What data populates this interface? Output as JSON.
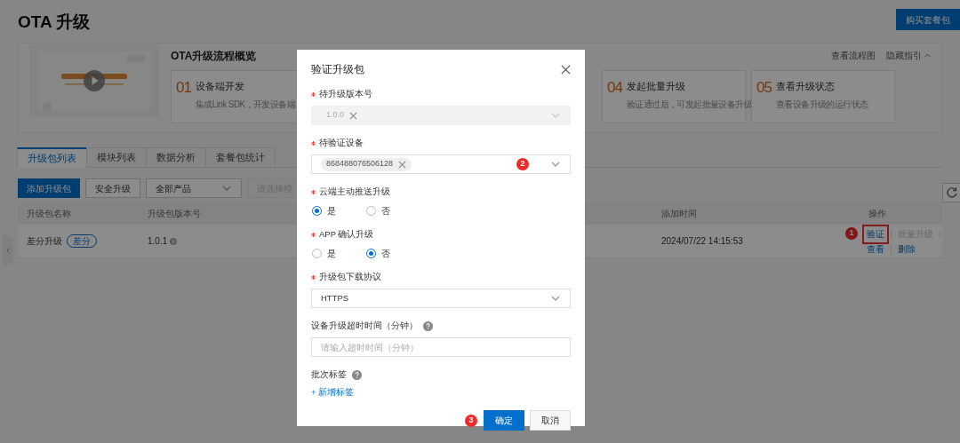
{
  "page": {
    "title": "OTA 升级",
    "buy_button": "购买套餐包"
  },
  "guide": {
    "title": "OTA升级流程概览",
    "links": [
      "查看流程图",
      "隐藏指引"
    ],
    "steps": [
      {
        "number": "01",
        "title": "设备端开发",
        "desc": "集成Link SDK，开发设备端"
      },
      {
        "number": "04",
        "title": "发起批量升级",
        "desc": "验证通过后，可发起批量设备升级"
      },
      {
        "number": "05",
        "title": "查看升级状态",
        "desc": "查看设备升级的运行状态"
      }
    ]
  },
  "tabs": [
    {
      "label": "升级包列表",
      "selected": true
    },
    {
      "label": "模块列表",
      "selected": false
    },
    {
      "label": "数据分析",
      "selected": false
    },
    {
      "label": "套餐包统计",
      "selected": false
    }
  ],
  "toolbar": {
    "add_button": "添加升级包",
    "secure_button": "安全升级",
    "product_select": "全部产品",
    "module_select": {
      "placeholder": "请选择模",
      "disabled": true
    }
  },
  "table": {
    "columns": [
      "升级包名称",
      "升级包版本号",
      "添加时间",
      "操作"
    ],
    "rows": [
      {
        "name": "差分升级",
        "tag": "差分",
        "version": "1.0.1",
        "added": "2024/07/22 14:15:53",
        "actions": [
          {
            "label": "验证",
            "disabled": false,
            "highlighted": true,
            "marker": "1"
          },
          {
            "label": "批量升级",
            "disabled": true,
            "highlighted": false
          },
          {
            "label": "查看",
            "disabled": false,
            "highlighted": false
          },
          {
            "label": "删除",
            "disabled": false,
            "highlighted": false
          }
        ]
      }
    ]
  },
  "dialog": {
    "title": "验证升级包",
    "fields": [
      {
        "kind": "select",
        "label": "待升级版本号",
        "required": true,
        "disabled": true,
        "tags": [
          "1.0.0"
        ]
      },
      {
        "kind": "select",
        "label": "待验证设备",
        "required": true,
        "disabled": false,
        "tags": [
          "868488076506128"
        ],
        "marker": "2"
      },
      {
        "kind": "radio",
        "label": "云端主动推送升级",
        "required": true,
        "options": [
          {
            "label": "是",
            "selected": true
          },
          {
            "label": "否",
            "selected": false
          }
        ]
      },
      {
        "kind": "radio",
        "label": "APP 确认升级",
        "required": true,
        "options": [
          {
            "label": "是",
            "selected": false
          },
          {
            "label": "否",
            "selected": true
          }
        ]
      },
      {
        "kind": "select",
        "label": "升级包下载协议",
        "required": true,
        "disabled": false,
        "value": "HTTPS"
      },
      {
        "kind": "input",
        "label": "设备升级超时时间（分钟）",
        "help": true,
        "placeholder": "请输入超时时间（分钟）"
      },
      {
        "kind": "tags",
        "label": "批次标签",
        "help": true,
        "link": "+ 新增标签"
      }
    ],
    "buttons": [
      {
        "label": "确定",
        "kind": "primary",
        "marker": "3"
      },
      {
        "label": "取消",
        "kind": "default"
      }
    ]
  }
}
